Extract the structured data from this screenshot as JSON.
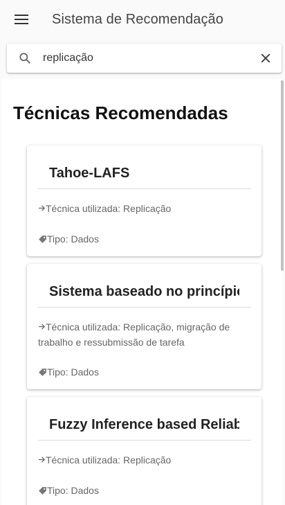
{
  "appbar": {
    "title": "Sistema de Recomendação"
  },
  "search": {
    "value": "replicação"
  },
  "section": {
    "title": "Técnicas Recomendadas"
  },
  "cards": [
    {
      "title": "Tahoe-LAFS",
      "technique": "Técnica utilizada: Replicação",
      "type": "Tipo: Dados"
    },
    {
      "title": "Sistema baseado no princípio",
      "technique": "Técnica utilizada: Replicação, migração de trabalho e ressubmissão de tarefa",
      "type": "Tipo: Dados"
    },
    {
      "title": "Fuzzy Inference based Reliability",
      "technique": "Técnica utilizada: Replicação",
      "type": "Tipo: Dados"
    }
  ]
}
